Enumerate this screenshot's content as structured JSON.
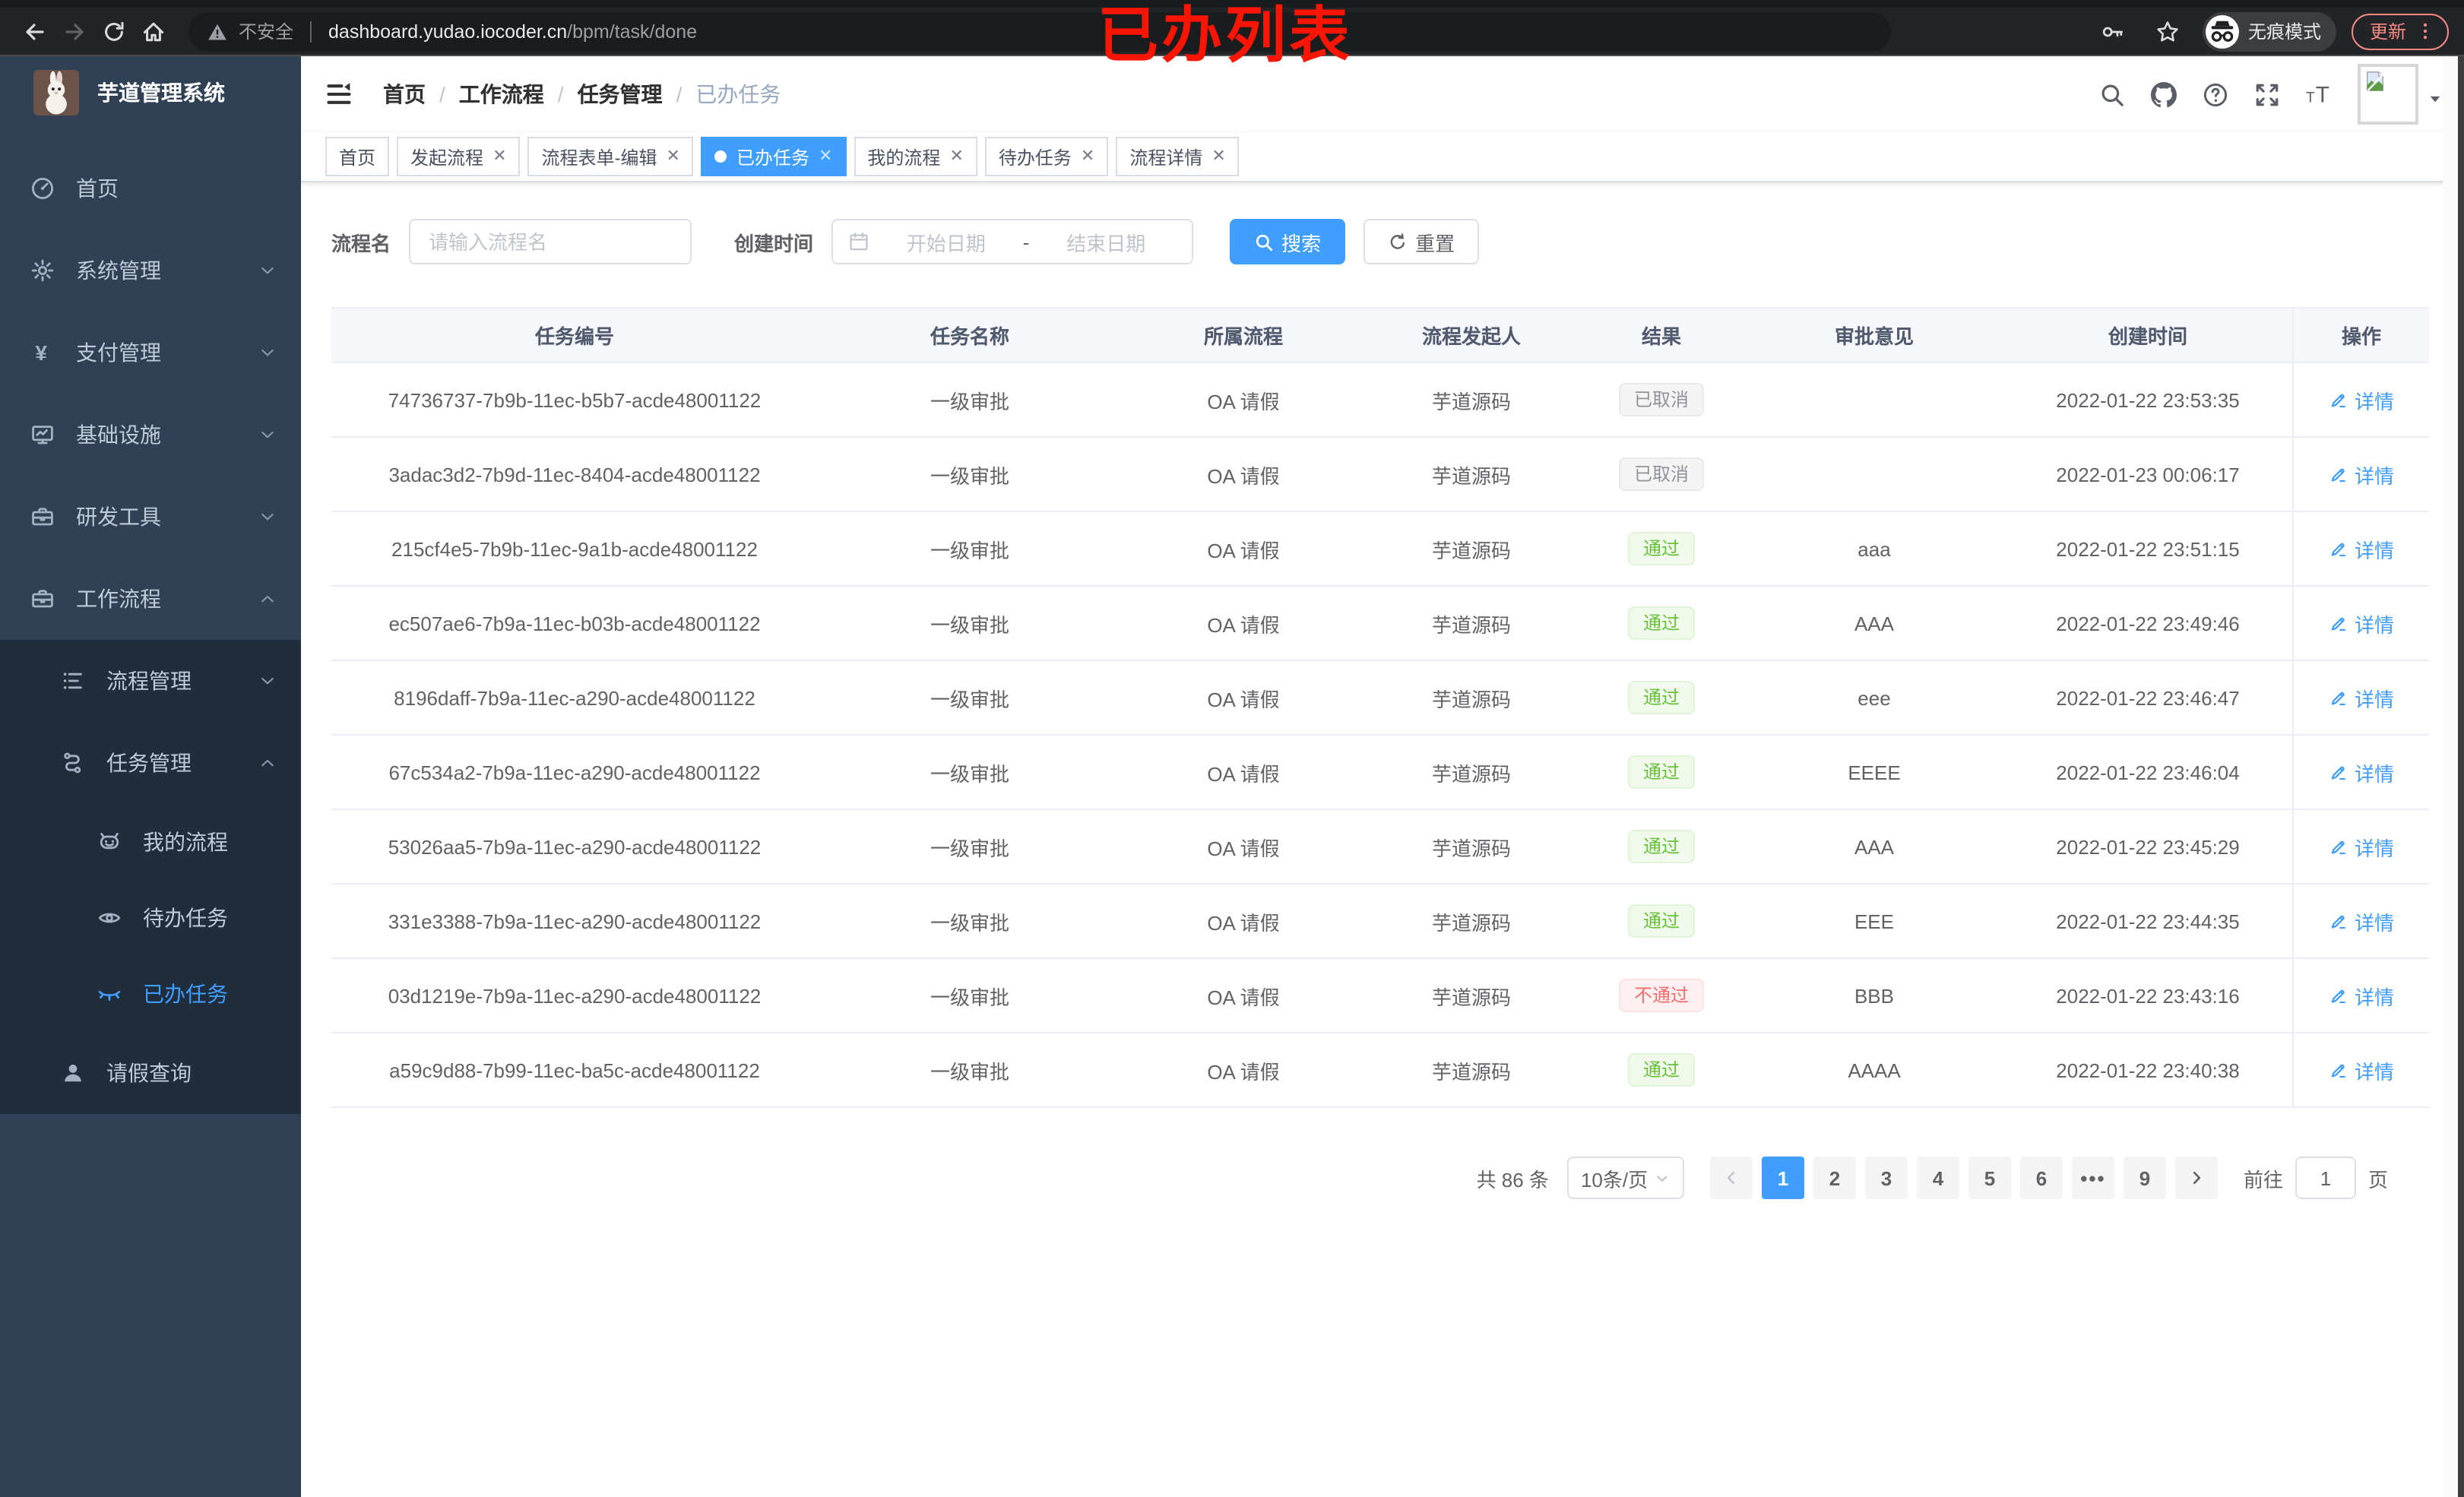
{
  "browser": {
    "security_label": "不安全",
    "url_domain": "dashboard.yudao.iocoder.cn",
    "url_path": "/bpm/task/done",
    "incognito_label": "无痕模式",
    "update_label": "更新",
    "overlay_text": "已办列表"
  },
  "sidebar": {
    "app_title": "芋道管理系统",
    "menu": [
      {
        "name": "home",
        "label": "首页",
        "icon": "dashboard-icon",
        "level": 1
      },
      {
        "name": "system",
        "label": "系统管理",
        "icon": "gear-icon",
        "level": 1,
        "chevron": "down"
      },
      {
        "name": "payment",
        "label": "支付管理",
        "icon": "yen-icon",
        "level": 1,
        "chevron": "down"
      },
      {
        "name": "infrastructure",
        "label": "基础设施",
        "icon": "monitor-icon",
        "level": 1,
        "chevron": "down"
      },
      {
        "name": "dev-tools",
        "label": "研发工具",
        "icon": "toolbox-icon",
        "level": 1,
        "chevron": "down"
      },
      {
        "name": "workflow",
        "label": "工作流程",
        "icon": "briefcase-icon",
        "level": 1,
        "chevron": "up"
      },
      {
        "name": "process-mgmt",
        "label": "流程管理",
        "icon": "list-tree-icon",
        "level": 2,
        "chevron": "down"
      },
      {
        "name": "task-mgmt",
        "label": "任务管理",
        "icon": "flow-icon",
        "level": 2,
        "chevron": "up"
      },
      {
        "name": "my-process",
        "label": "我的流程",
        "icon": "robot-icon",
        "level": 3
      },
      {
        "name": "todo-tasks",
        "label": "待办任务",
        "icon": "eye-open-icon",
        "level": 3
      },
      {
        "name": "done-tasks",
        "label": "已办任务",
        "icon": "eye-closed-icon",
        "level": 3,
        "active": true
      },
      {
        "name": "leave-query",
        "label": "请假查询",
        "icon": "user-icon",
        "level": 2
      }
    ]
  },
  "breadcrumb": {
    "items": [
      "首页",
      "工作流程",
      "任务管理",
      "已办任务"
    ]
  },
  "tabs": [
    {
      "name": "home",
      "label": "首页",
      "closable": false,
      "active": false
    },
    {
      "name": "start-process",
      "label": "发起流程",
      "closable": true,
      "active": false
    },
    {
      "name": "form-edit",
      "label": "流程表单-编辑",
      "closable": true,
      "active": false
    },
    {
      "name": "done-tasks",
      "label": "已办任务",
      "closable": true,
      "active": true
    },
    {
      "name": "my-process",
      "label": "我的流程",
      "closable": true,
      "active": false
    },
    {
      "name": "todo-tasks",
      "label": "待办任务",
      "closable": true,
      "active": false
    },
    {
      "name": "process-detail",
      "label": "流程详情",
      "closable": true,
      "active": false
    }
  ],
  "filters": {
    "name_label": "流程名",
    "name_placeholder": "请输入流程名",
    "time_label": "创建时间",
    "start_placeholder": "开始日期",
    "range_separator": "-",
    "end_placeholder": "结束日期",
    "search_label": "搜索",
    "reset_label": "重置"
  },
  "table": {
    "headers": [
      "任务编号",
      "任务名称",
      "所属流程",
      "流程发起人",
      "结果",
      "审批意见",
      "创建时间",
      "操作"
    ],
    "action_label": "详情",
    "rows": [
      {
        "id": "74736737-7b9b-11ec-b5b7-acde48001122",
        "name": "一级审批",
        "process": "OA 请假",
        "starter": "芋道源码",
        "result": {
          "label": "已取消",
          "type": "info"
        },
        "comment": "",
        "time": "2022-01-22 23:53:35"
      },
      {
        "id": "3adac3d2-7b9d-11ec-8404-acde48001122",
        "name": "一级审批",
        "process": "OA 请假",
        "starter": "芋道源码",
        "result": {
          "label": "已取消",
          "type": "info"
        },
        "comment": "",
        "time": "2022-01-23 00:06:17"
      },
      {
        "id": "215cf4e5-7b9b-11ec-9a1b-acde48001122",
        "name": "一级审批",
        "process": "OA 请假",
        "starter": "芋道源码",
        "result": {
          "label": "通过",
          "type": "success"
        },
        "comment": "aaa",
        "time": "2022-01-22 23:51:15"
      },
      {
        "id": "ec507ae6-7b9a-11ec-b03b-acde48001122",
        "name": "一级审批",
        "process": "OA 请假",
        "starter": "芋道源码",
        "result": {
          "label": "通过",
          "type": "success"
        },
        "comment": "AAA",
        "time": "2022-01-22 23:49:46"
      },
      {
        "id": "8196daff-7b9a-11ec-a290-acde48001122",
        "name": "一级审批",
        "process": "OA 请假",
        "starter": "芋道源码",
        "result": {
          "label": "通过",
          "type": "success"
        },
        "comment": "eee",
        "time": "2022-01-22 23:46:47"
      },
      {
        "id": "67c534a2-7b9a-11ec-a290-acde48001122",
        "name": "一级审批",
        "process": "OA 请假",
        "starter": "芋道源码",
        "result": {
          "label": "通过",
          "type": "success"
        },
        "comment": "EEEE",
        "time": "2022-01-22 23:46:04"
      },
      {
        "id": "53026aa5-7b9a-11ec-a290-acde48001122",
        "name": "一级审批",
        "process": "OA 请假",
        "starter": "芋道源码",
        "result": {
          "label": "通过",
          "type": "success"
        },
        "comment": "AAA",
        "time": "2022-01-22 23:45:29"
      },
      {
        "id": "331e3388-7b9a-11ec-a290-acde48001122",
        "name": "一级审批",
        "process": "OA 请假",
        "starter": "芋道源码",
        "result": {
          "label": "通过",
          "type": "success"
        },
        "comment": "EEE",
        "time": "2022-01-22 23:44:35"
      },
      {
        "id": "03d1219e-7b9a-11ec-a290-acde48001122",
        "name": "一级审批",
        "process": "OA 请假",
        "starter": "芋道源码",
        "result": {
          "label": "不通过",
          "type": "danger"
        },
        "comment": "BBB",
        "time": "2022-01-22 23:43:16"
      },
      {
        "id": "a59c9d88-7b99-11ec-ba5c-acde48001122",
        "name": "一级审批",
        "process": "OA 请假",
        "starter": "芋道源码",
        "result": {
          "label": "通过",
          "type": "success"
        },
        "comment": "AAAA",
        "time": "2022-01-22 23:40:38"
      }
    ]
  },
  "pagination": {
    "total": "共 86 条",
    "page_size": "10条/页",
    "pages": [
      "1",
      "2",
      "3",
      "4",
      "5",
      "6",
      "•••",
      "9"
    ],
    "active_page": "1",
    "goto_label": "前往",
    "goto_value": "1",
    "page_unit": "页"
  },
  "colors": {
    "primary": "#409eff",
    "sidebar_bg": "#304156",
    "submenu_bg": "#1f2d3d",
    "success": "#67c23a",
    "danger": "#f56c6c",
    "info": "#909399",
    "tab_active_bg": "#409eff",
    "overlay_red": "#fb1505"
  }
}
